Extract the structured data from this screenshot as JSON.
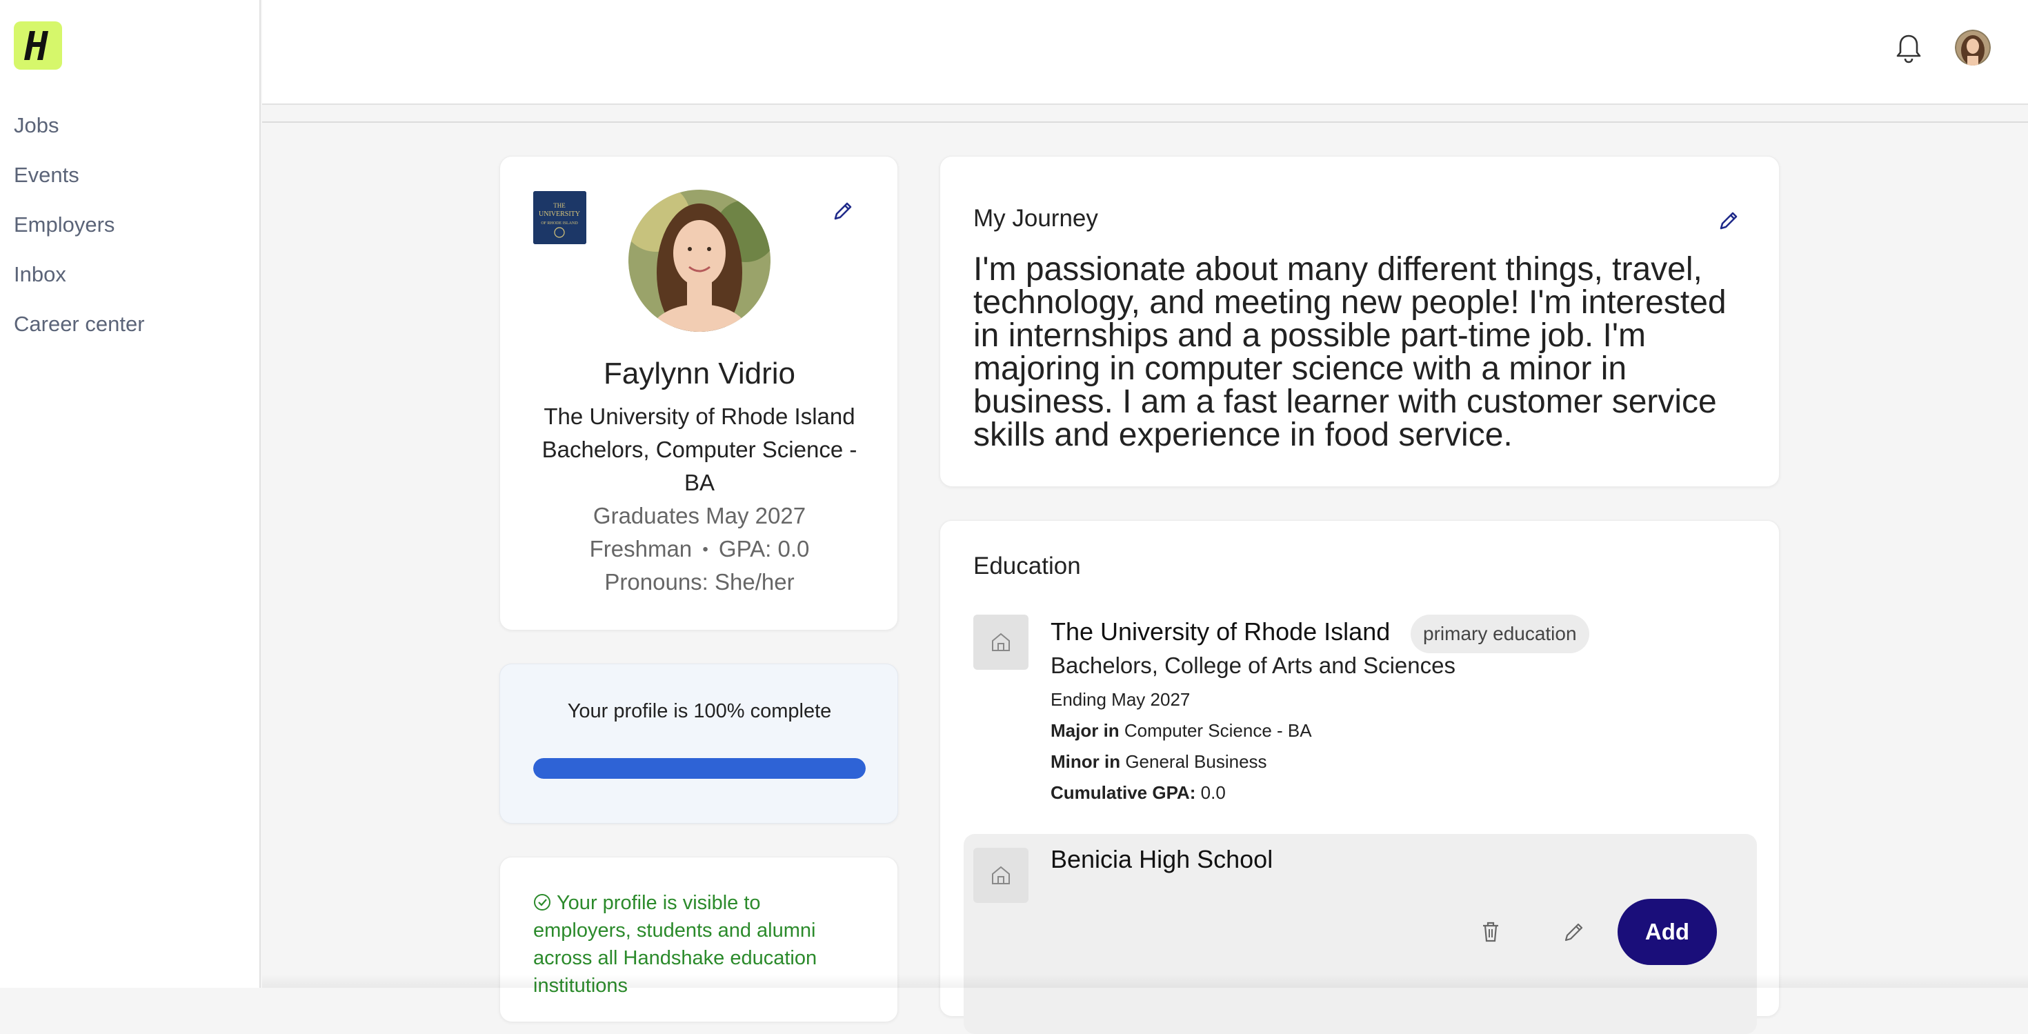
{
  "sidebar": {
    "logo_letter": "H",
    "items": [
      {
        "label": "Jobs"
      },
      {
        "label": "Events"
      },
      {
        "label": "Employers"
      },
      {
        "label": "Inbox"
      },
      {
        "label": "Career center"
      }
    ]
  },
  "header": {
    "icons": [
      "bell-icon",
      "user-avatar"
    ]
  },
  "profile": {
    "name": "Faylynn Vidrio",
    "school": "The University of Rhode Island",
    "degree": "Bachelors, Computer Science - BA",
    "graduation": "Graduates May 2027",
    "year": "Freshman",
    "separator": "•",
    "gpa": "GPA: 0.0",
    "pronouns": "Pronouns: She/her"
  },
  "completion": {
    "text": "Your profile is 100% complete",
    "percent": 100,
    "color": "#2e63d6"
  },
  "visibility": {
    "text": "Your profile is visible to employers, students and alumni across all Handshake education institutions",
    "color": "#2b8a2b"
  },
  "journey": {
    "title": "My Journey",
    "text": "I'm passionate about many different things, travel, technology, and meeting new people! I'm interested in internships and a possible part-time job. I'm majoring in computer science with a minor in business. I am a fast learner with customer service skills and experience in food service."
  },
  "education": {
    "title": "Education",
    "entries": [
      {
        "school": "The University of Rhode Island",
        "tag": "primary education",
        "degree": "Bachelors, College of Arts and Sciences",
        "ending": "Ending May 2027",
        "major_label": "Major in",
        "major": "Computer Science - BA",
        "minor_label": "Minor in",
        "minor": "General Business",
        "gpa_label": "Cumulative GPA:",
        "gpa": "0.0"
      },
      {
        "school": "Benicia High School"
      }
    ],
    "add_label": "Add"
  },
  "colors": {
    "accent_lime": "#d6f76b",
    "add_button": "#1a0e7a",
    "pencil": "#1f2a8a"
  }
}
